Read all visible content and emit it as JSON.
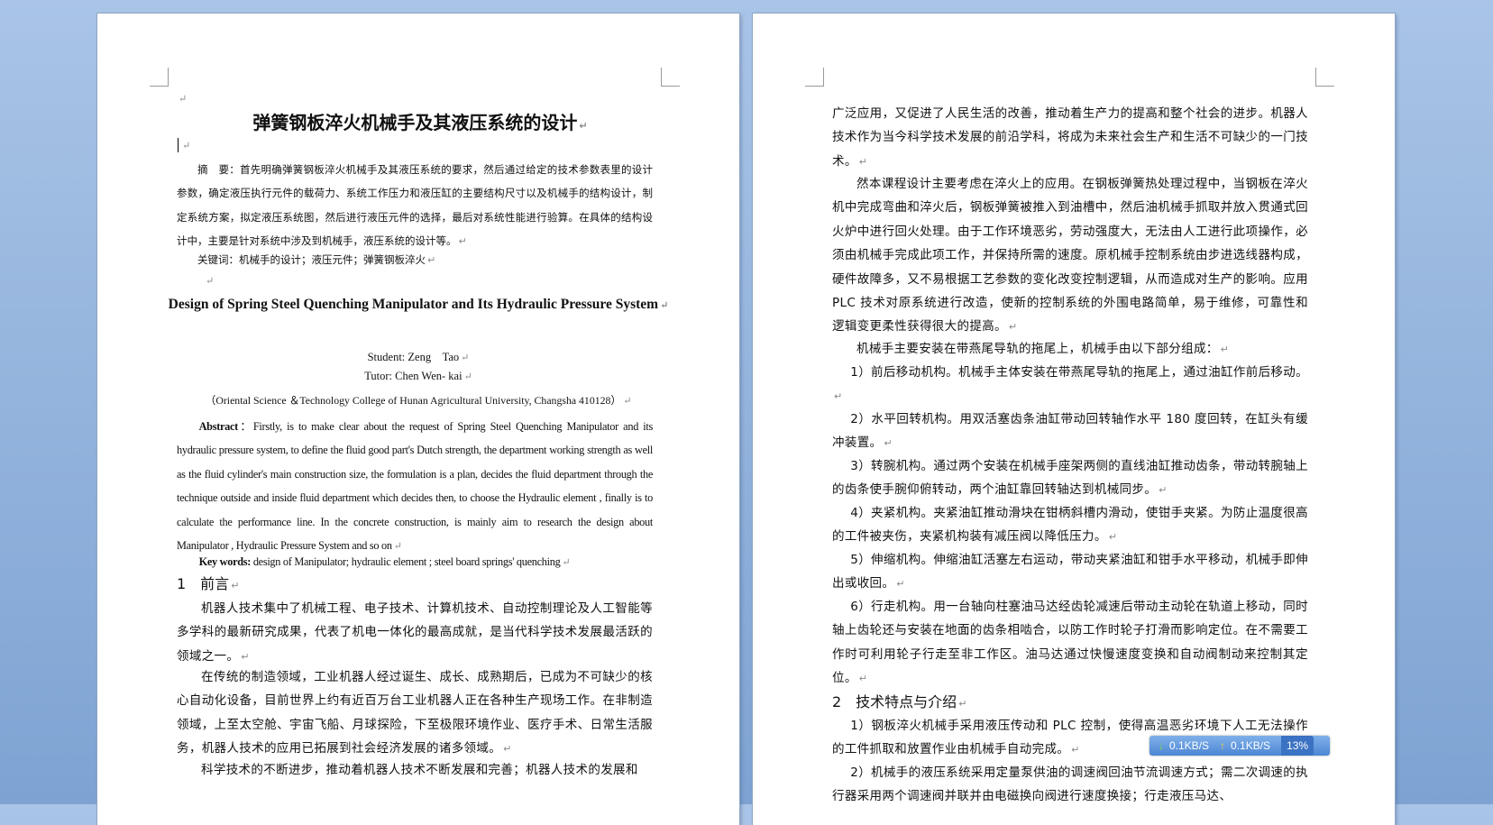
{
  "left_page": {
    "blank_mark": "↵",
    "title_zh": "弹簧钢板淬火机械手及其液压系统的设计",
    "abstract_zh": "摘　要：首先明确弹簧钢板淬火机械手及其液压系统的要求，然后通过给定的技术参数表里的设计参数，确定液压执行元件的载荷力、系统工作压力和液压缸的主要结构尺寸以及机械手的结构设计，制定系统方案，拟定液压系统图，然后进行液压元件的选择，最后对系统性能进行验算。在具体的结构设计中，主要是针对系统中涉及到机械手，液压系统的设计等。",
    "keywords_zh": "关键词：机械手的设计；液压元件；弹簧钢板淬火",
    "title_en": "Design of Spring Steel Quenching Manipulator and Its Hydraulic Pressure System",
    "student": "Student: Zeng　Tao",
    "tutor": "Tutor: Chen Wen- kai",
    "affiliation": "（Oriental Science ＆Technology College of Hunan Agricultural University, Changsha 410128）",
    "abstract_en_label": "Abstract",
    "abstract_en": "：Firstly, is to make clear about the request of Spring Steel Quenching Manipulator and its hydraulic pressure system, to define the fluid good part's Dutch strength, the department working strength as well as the fluid cylinder's main construction size, the formulation is a plan, decides the fluid department through the technique outside and inside fluid department which decides then, to choose the Hydraulic element , finally is to calculate the performance line. In the concrete construction, is mainly aim to research the design about Manipulator , Hydraulic Pressure System and so on",
    "keywords_en_label": "Key words:",
    "keywords_en": " design of Manipulator; hydraulic element ; steel board springs' quenching",
    "section1_heading": "1　前言",
    "section1_p1": "机器人技术集中了机械工程、电子技术、计算机技术、自动控制理论及人工智能等多学科的最新研究成果，代表了机电一体化的最高成就，是当代科学技术发展最活跃的领域之一。",
    "section1_p2": "在传统的制造领域，工业机器人经过诞生、成长、成熟期后，已成为不可缺少的核心自动化设备，目前世界上约有近百万台工业机器人正在各种生产现场工作。在非制造领域，上至太空舱、宇宙飞船、月球探险，下至极限环境作业、医疗手术、日常生活服务，机器人技术的应用已拓展到社会经济发展的诸多领域。",
    "section1_p3": "科学技术的不断进步，推动着机器人技术不断发展和完善；机器人技术的发展和"
  },
  "right_page": {
    "p_continue": "广泛应用，又促进了人民生活的改善，推动着生产力的提高和整个社会的进步。机器人技术作为当今科学技术发展的前沿学科，将成为未来社会生产和生活不可缺少的一门技术。",
    "p_design": "然本课程设计主要考虑在淬火上的应用。在钢板弹簧热处理过程中，当钢板在淬火机中完成弯曲和淬火后，钢板弹簧被推入到油槽中，然后油机械手抓取并放入贯通式回火炉中进行回火处理。由于工作环境恶劣，劳动强度大，无法由人工进行此项操作，必须由机械手完成此项工作，并保持所需的速度。原机械手控制系统由步进选线器构成，硬件故障多，又不易根据工艺参数的变化改变控制逻辑，从而造成对生产的影响。应用 PLC 技术对原系统进行改造，使新的控制系统的外围电路简单，易于维修，可靠性和逻辑变更柔性获得很大的提高。",
    "p_intro": "机械手主要安装在带燕尾导轨的拖尾上，机械手由以下部分组成：",
    "item1": "1）前后移动机构。机械手主体安装在带燕尾导轨的拖尾上，通过油缸作前后移动。",
    "item2": "2）水平回转机构。用双活塞齿条油缸带动回转轴作水平 180 度回转，在缸头有缓冲装置。",
    "item3": "3）转腕机构。通过两个安装在机械手座架两侧的直线油缸推动齿条，带动转腕轴上的齿条使手腕仰俯转动，两个油缸靠回转轴达到机械同步。",
    "item4": "4）夹紧机构。夹紧油缸推动滑块在钳柄斜槽内滑动，使钳手夹紧。为防止温度很高的工件被夹伤，夹紧机构装有减压阀以降低压力。",
    "item5": "5）伸缩机构。伸缩油缸活塞左右运动，带动夹紧油缸和钳手水平移动，机械手即伸出或收回。",
    "item6": "6）行走机构。用一台轴向柱塞油马达经齿轮减速后带动主动轮在轨道上移动，同时轴上齿轮还与安装在地面的齿条相啮合，以防工作时轮子打滑而影响定位。在不需要工作时可利用轮子行走至非工作区。油马达通过快慢速度变换和自动阀制动来控制其定位。",
    "section2_heading": "2　技术特点与介绍",
    "feat1": "1）钢板淬火机械手采用液压传动和 PLC 控制，使得高温恶劣环境下人工无法操作的工件抓取和放置作业由机械手自动完成。",
    "feat2": "2）机械手的液压系统采用定量泵供油的调速阀回油节流调速方式；需二次调速的执行器采用两个调速阀并联并由电磁换向阀进行速度换接；行走液压马达、"
  },
  "net_widget": {
    "down_speed": "0.1KB/S",
    "up_speed": "0.1KB/S",
    "percent": "13%"
  }
}
